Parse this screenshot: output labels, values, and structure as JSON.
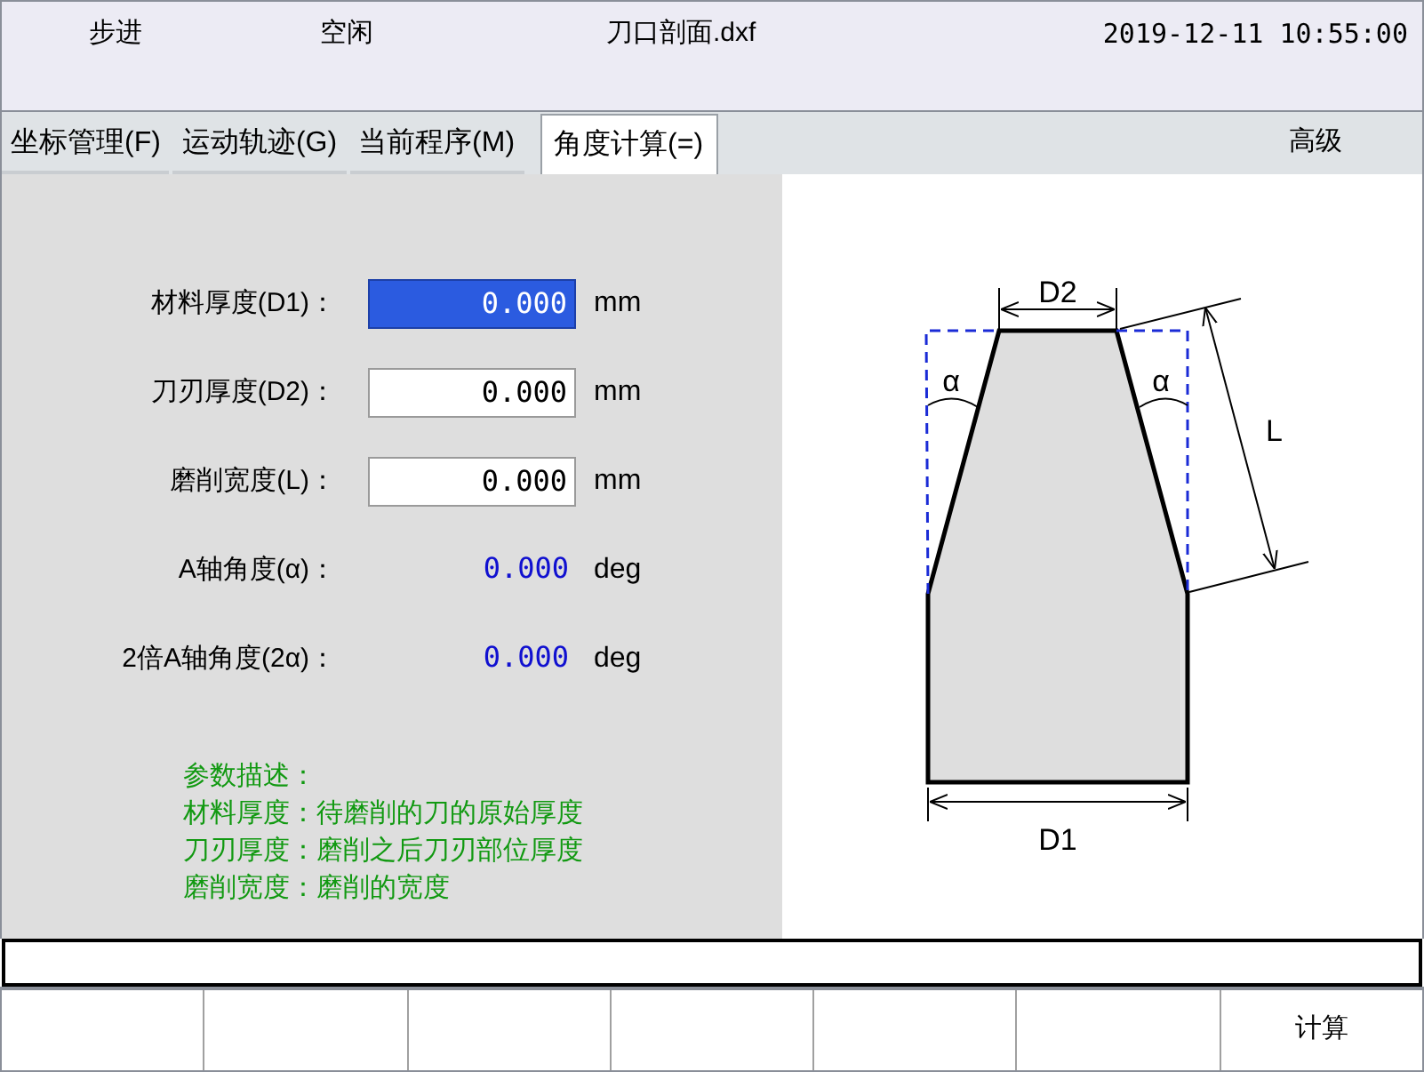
{
  "header": {
    "mode": "步进",
    "state": "空闲",
    "file": "刀口剖面.dxf",
    "datetime": "2019-12-11 10:55:00"
  },
  "tabs": [
    {
      "label": "坐标管理(F)",
      "selected": false
    },
    {
      "label": "运动轨迹(G)",
      "selected": false
    },
    {
      "label": "当前程序(M)",
      "selected": false
    },
    {
      "label": "角度计算(=)",
      "selected": true
    }
  ],
  "advanced": "高级",
  "fields": [
    {
      "kind": "input",
      "label": "材料厚度(D1)：",
      "value": "0.000",
      "unit": "mm",
      "selected": true
    },
    {
      "kind": "input",
      "label": "刀刃厚度(D2)：",
      "value": "0.000",
      "unit": "mm",
      "selected": false
    },
    {
      "kind": "input",
      "label": "磨削宽度(L)：",
      "value": "0.000",
      "unit": "mm",
      "selected": false
    },
    {
      "kind": "readout",
      "label": "A轴角度(α)：",
      "value": "0.000",
      "unit": "deg"
    },
    {
      "kind": "readout",
      "label": "2倍A轴角度(2α)：",
      "value": "0.000",
      "unit": "deg"
    }
  ],
  "description": [
    "参数描述：",
    "材料厚度：待磨削的刀的原始厚度",
    "刀刃厚度：磨削之后刀刃部位厚度",
    "磨削宽度：磨削的宽度"
  ],
  "diagram": {
    "top_label": "D2",
    "bottom_label": "D1",
    "side_label": "L",
    "angle_labels": [
      "α",
      "α"
    ]
  },
  "calc_button": "计算"
}
